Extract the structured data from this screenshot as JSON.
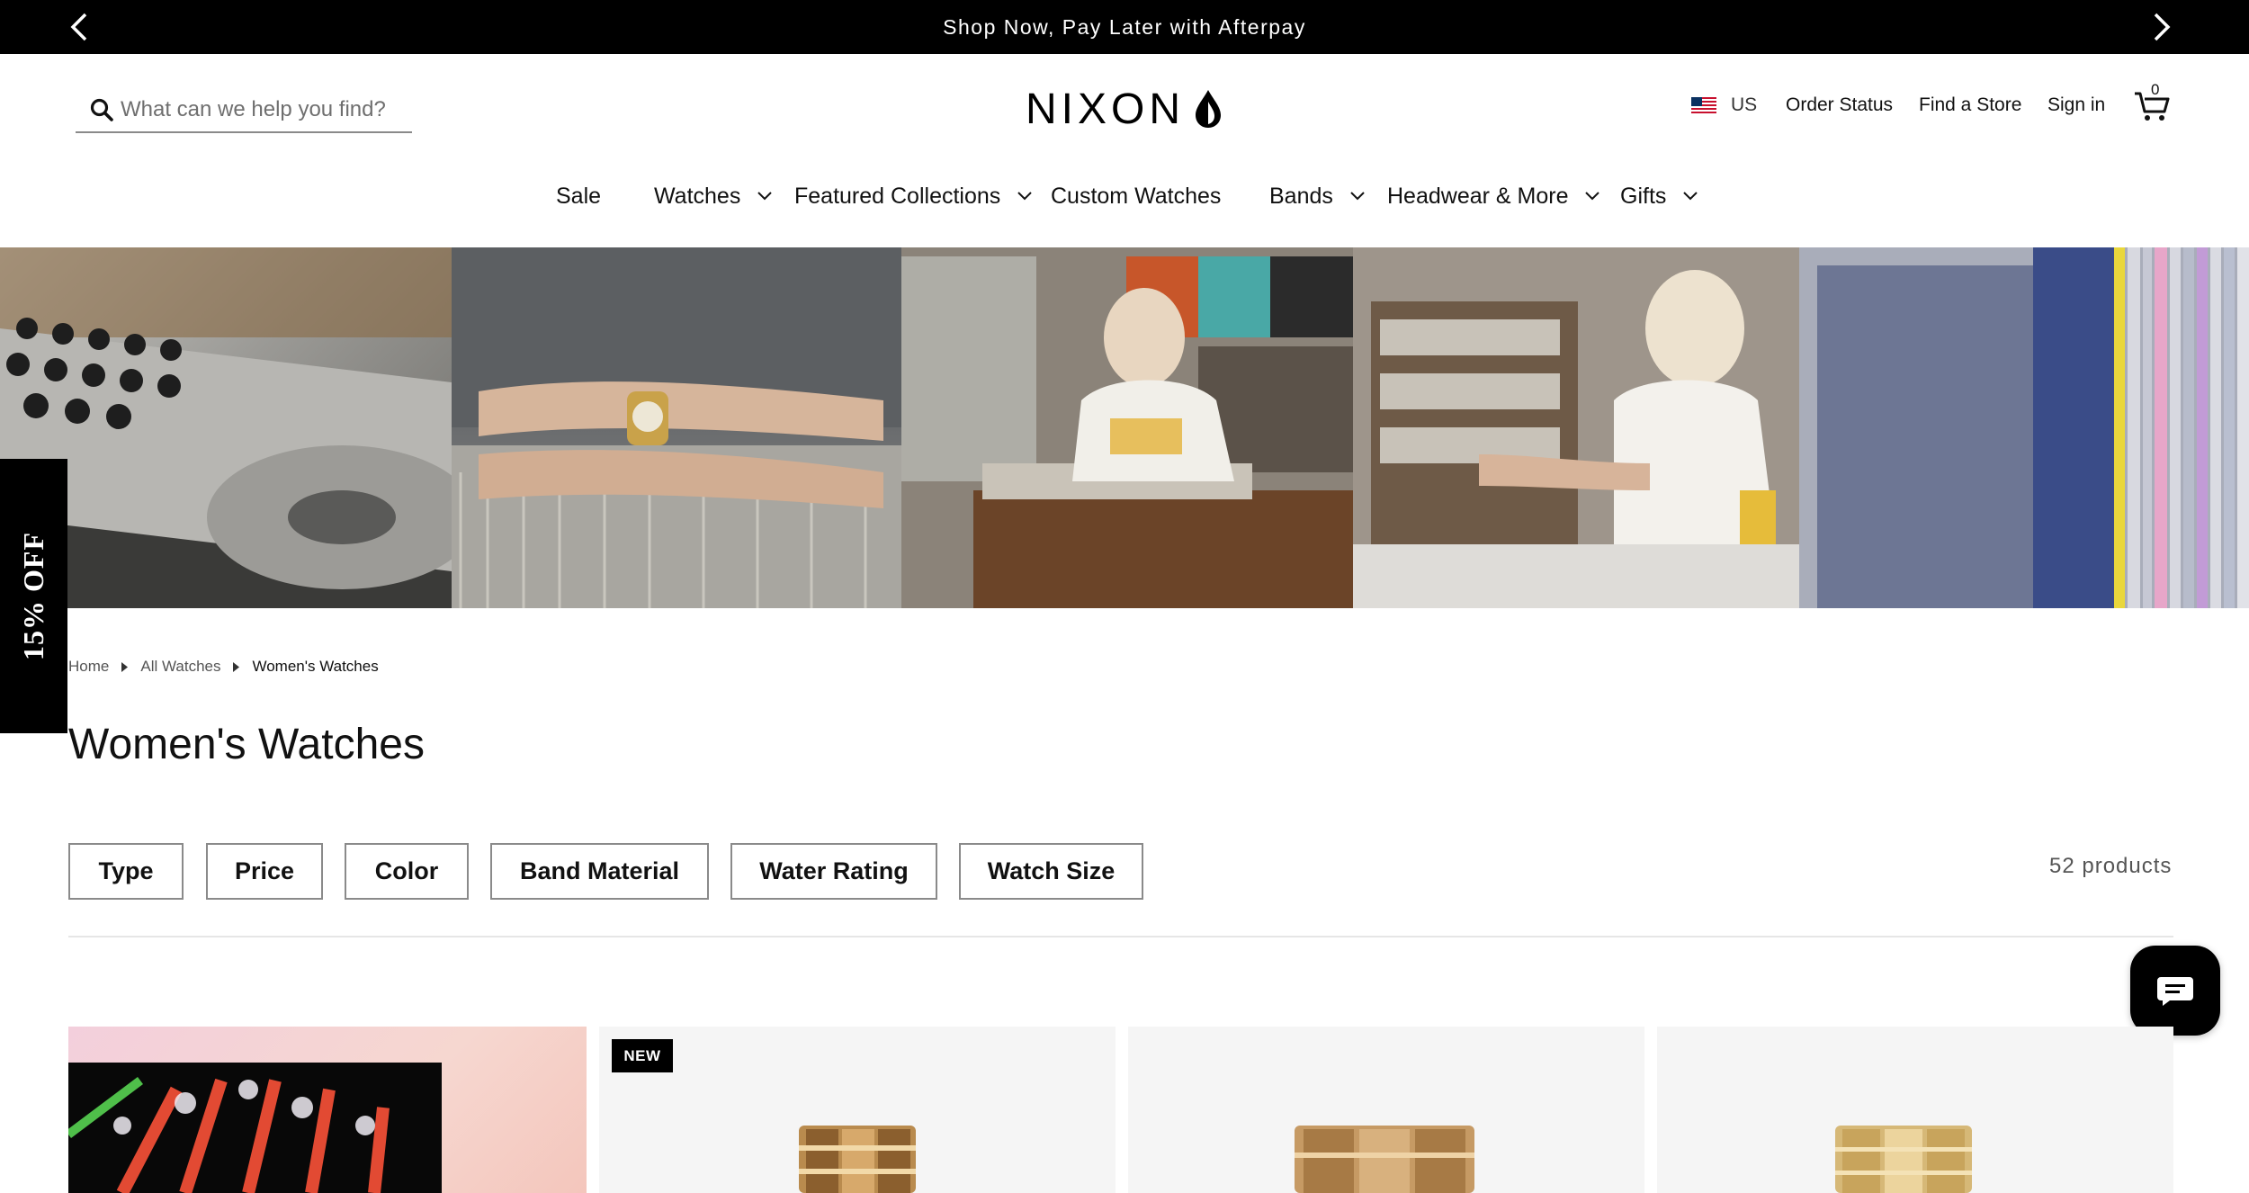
{
  "announcement": {
    "message": "Shop Now, Pay Later with Afterpay",
    "prev_icon": "chevron-left-icon",
    "next_icon": "chevron-right-icon"
  },
  "header": {
    "search_placeholder": "What can we help you find?",
    "logo_text": "NIXON",
    "country_code": "US",
    "order_status": "Order Status",
    "find_store": "Find a Store",
    "sign_in": "Sign in",
    "cart_count": "0"
  },
  "nav": {
    "items": [
      {
        "label": "Sale",
        "has_dropdown": false
      },
      {
        "label": "Watches",
        "has_dropdown": true
      },
      {
        "label": "Featured Collections",
        "has_dropdown": true
      },
      {
        "label": "Custom Watches",
        "has_dropdown": false
      },
      {
        "label": "Bands",
        "has_dropdown": true
      },
      {
        "label": "Headwear & More",
        "has_dropdown": true
      },
      {
        "label": "Gifts",
        "has_dropdown": true
      }
    ]
  },
  "promo_tab": "15% OFF",
  "breadcrumb": {
    "items": [
      "Home",
      "All Watches",
      "Women's Watches"
    ]
  },
  "page_title": "Women's Watches",
  "filters": [
    "Type",
    "Price",
    "Color",
    "Band Material",
    "Water Rating",
    "Watch Size"
  ],
  "product_count": "52 products",
  "products": {
    "badge": "NEW"
  },
  "colors": {
    "bar": "#000000",
    "text": "#111111",
    "muted": "#555555",
    "border": "#8a8a8a",
    "card_bg": "#f5f5f5"
  }
}
